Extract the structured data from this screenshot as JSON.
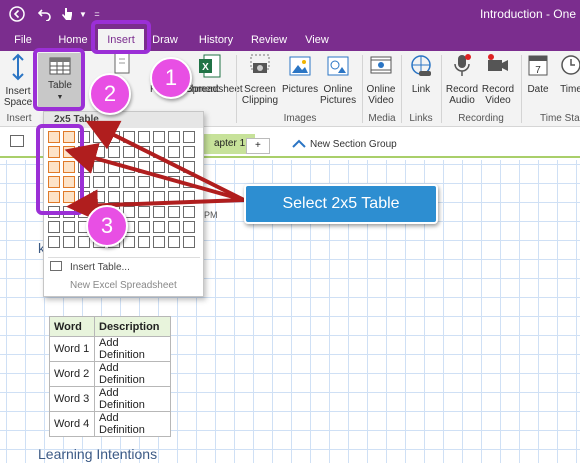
{
  "window": {
    "title": "Introduction - One"
  },
  "tabs": [
    {
      "label": "File"
    },
    {
      "label": "Home"
    },
    {
      "label": "Insert"
    },
    {
      "label": "Draw"
    },
    {
      "label": "History"
    },
    {
      "label": "Review"
    },
    {
      "label": "View"
    }
  ],
  "ribbon": {
    "insert_space": "Insert Space",
    "table": "Table",
    "file_attachment": "File Attachment",
    "spreadsheet": "Spreadsheet",
    "screen_clipping": "Screen Clipping",
    "pictures": "Pictures",
    "online_pictures": "Online Pictures",
    "online_video": "Online Video",
    "link": "Link",
    "record_audio": "Record Audio",
    "record_video": "Record Video",
    "date": "Date",
    "time": "Time",
    "groups": {
      "insert": "Insert",
      "images": "Images",
      "media": "Media",
      "links": "Links",
      "recording": "Recording",
      "time_stamp": "Time Sta"
    }
  },
  "page_bar": {
    "section_tab": "apter 1",
    "add_tab": "+",
    "new_section_group": "New Section Group"
  },
  "dropdown": {
    "header": "2x5 Table",
    "insert_table": "Insert Table...",
    "new_excel": "New Excel Spreadsheet",
    "selected_cols": 2,
    "selected_rows": 5
  },
  "callouts": {
    "step1": "1",
    "step2": "2",
    "step3": "3",
    "bubble": "Select 2x5 Table"
  },
  "page": {
    "time_fragment": "PM",
    "k_fragment": "k",
    "table_headers": [
      "Word",
      "Description"
    ],
    "table_rows": [
      [
        "Word 1",
        "Add Definition"
      ],
      [
        "Word 2",
        "Add Definition"
      ],
      [
        "Word 3",
        "Add Definition"
      ],
      [
        "Word 4",
        "Add Definition"
      ]
    ],
    "learning_intentions": "Learning Intentions"
  },
  "colors": {
    "accent": "#7b2d8e",
    "highlight": "#9b2fd6",
    "step_circle": "#e84fe4",
    "bubble": "#2d8ed1",
    "arrow": "#b01e1e"
  }
}
